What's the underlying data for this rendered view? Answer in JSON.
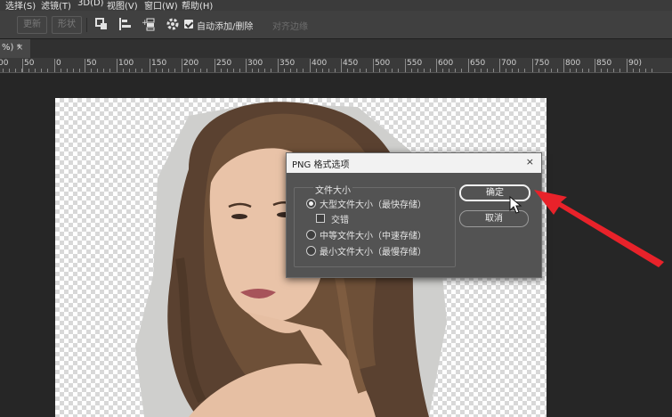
{
  "menubar": {
    "items": [
      "选择(S)",
      "滤镜(T)",
      "3D(D)",
      "视图(V)",
      "窗口(W)",
      "帮助(H)"
    ]
  },
  "options_bar": {
    "buttons": [
      "更新",
      "形状"
    ],
    "auto_add_delete_label": "自动添加/删除",
    "align_edges_label": "对齐边缘"
  },
  "document_tab": {
    "title": "%) *",
    "close": "×"
  },
  "ruler": {
    "labels": [
      "00",
      "50",
      "0",
      "50",
      "100",
      "150",
      "200",
      "250",
      "300",
      "350",
      "400",
      "450",
      "500",
      "550",
      "600",
      "650",
      "700",
      "750",
      "800",
      "850",
      "90)"
    ]
  },
  "png_dialog": {
    "title": "PNG 格式选项",
    "close": "×",
    "group_label": "文件大小",
    "options": [
      {
        "label": "大型文件大小（最快存储）",
        "selected": true
      },
      {
        "label": "中等文件大小（中速存储）",
        "selected": false
      },
      {
        "label": "最小文件大小（最慢存储）",
        "selected": false
      }
    ],
    "interlace_label": "交错",
    "ok_label": "确定",
    "cancel_label": "取消"
  },
  "colors": {
    "app_bg": "#262626",
    "annotation_arrow": "#e8222a"
  }
}
